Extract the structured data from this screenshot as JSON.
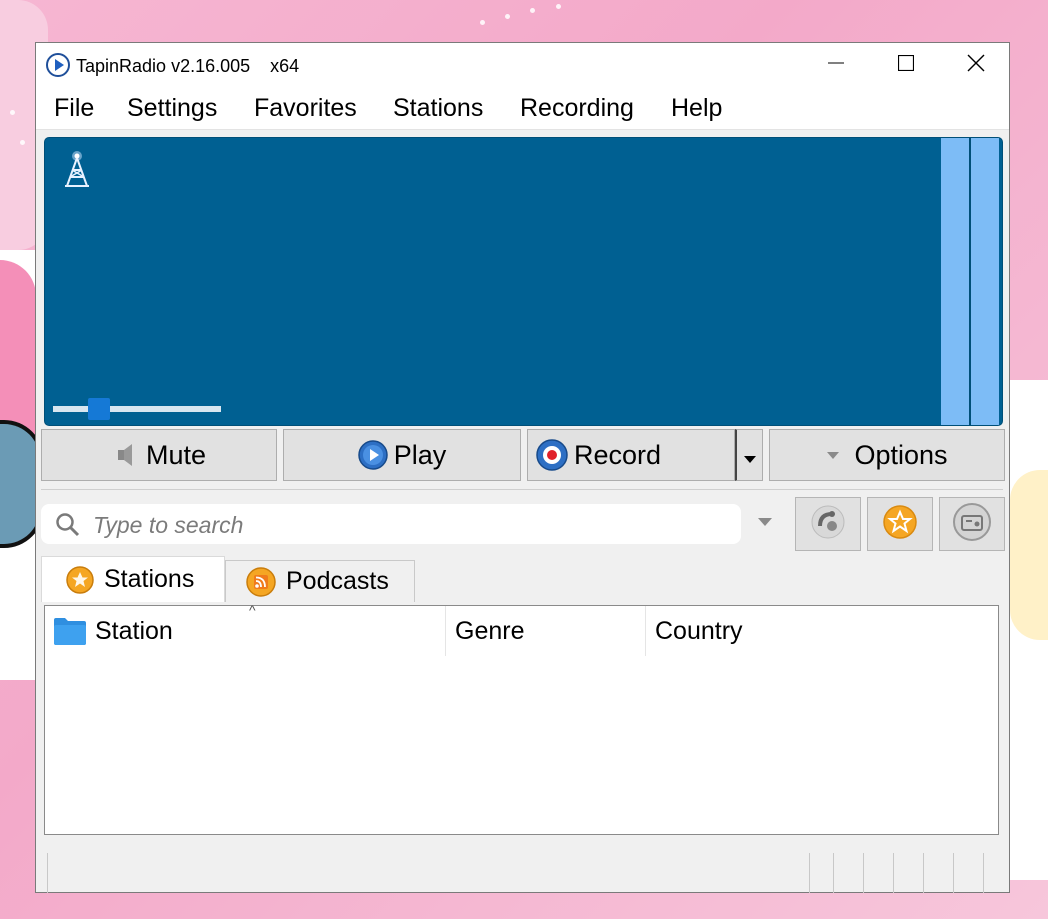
{
  "window": {
    "title": "TapinRadio v2.16.005    x64"
  },
  "menu": {
    "file": "File",
    "settings": "Settings",
    "favorites": "Favorites",
    "stations": "Stations",
    "recording": "Recording",
    "help": "Help"
  },
  "display": {
    "volume_level": 0.24
  },
  "controls": {
    "mute": "Mute",
    "play": "Play",
    "record": "Record",
    "options": "Options"
  },
  "search": {
    "placeholder": "Type to search",
    "value": ""
  },
  "tabs": {
    "stations": "Stations",
    "podcasts": "Podcasts",
    "active": "stations"
  },
  "list": {
    "columns": [
      "Station",
      "Genre",
      "Country"
    ],
    "sorted_by": "Station",
    "rows": []
  },
  "colors": {
    "display_bg": "#006092",
    "meter": "#7dbcf6",
    "volume_thumb": "#1579d6"
  },
  "icons": {
    "app": "tapinradio-play-icon",
    "tower": "radio-tower-icon",
    "mute": "speaker-icon",
    "play": "play-icon",
    "record": "record-icon",
    "options": "triangle-down-icon",
    "search": "search-icon",
    "tool_a": "phone-rotate-icon",
    "tool_b": "favorite-star-icon",
    "tool_c": "radio-icon",
    "stations_tab": "star-badge-icon",
    "podcasts_tab": "rss-icon",
    "station_col": "folder-icon"
  }
}
